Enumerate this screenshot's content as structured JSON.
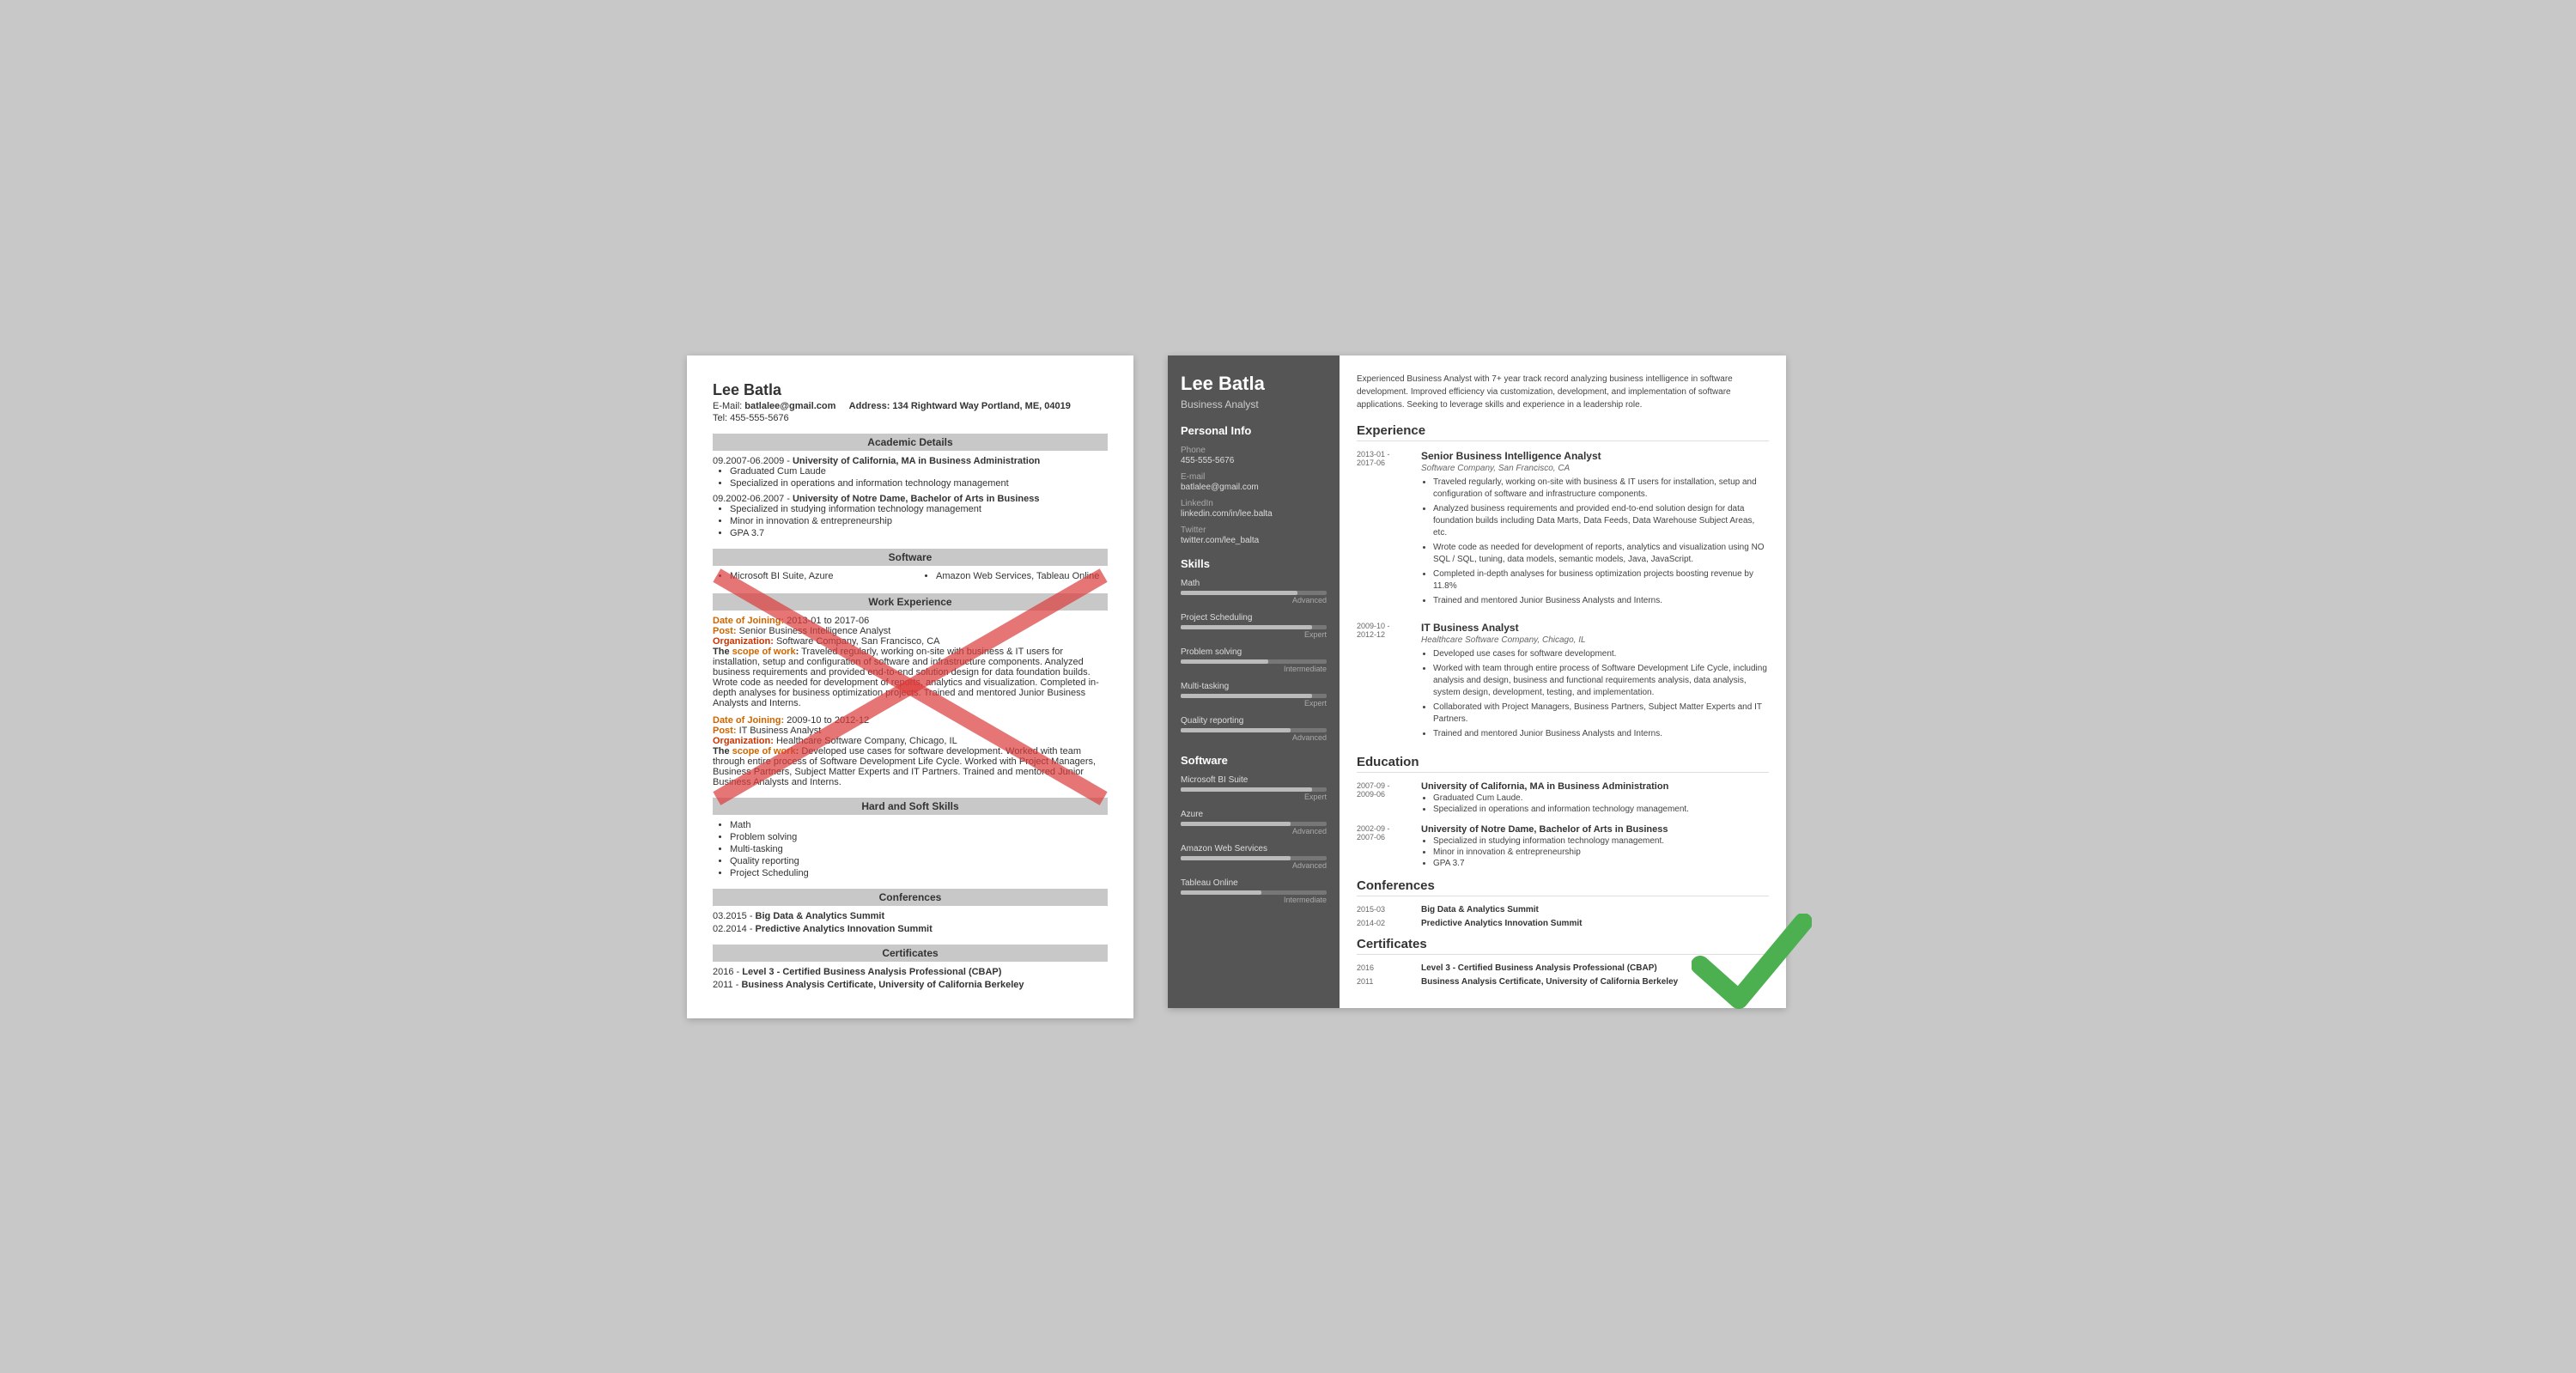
{
  "left_resume": {
    "name": "Lee Batla",
    "email": "batlalee@gmail.com",
    "address_label": "Address:",
    "address": "134 Rightward Way Portland, ME, 04019",
    "tel": "Tel: 455-555-5676",
    "sections": {
      "academic": "Academic Details",
      "software": "Software",
      "work": "Work Experience",
      "skills": "Hard and Soft Skills",
      "conferences": "Conferences",
      "certificates": "Certificates"
    },
    "education": [
      {
        "date": "09.2007-06.2009 -",
        "uni": "University of California, MA in Business Administration",
        "bullets": [
          "Graduated Cum Laude",
          "Specialized in operations and information technology management"
        ]
      },
      {
        "date": "09.2002-06.2007 -",
        "uni": "University of Notre Dame, Bachelor of Arts in Business",
        "bullets": [
          "Specialized in studying information technology management",
          "Minor in innovation & entrepreneurship",
          "GPA 3.7"
        ]
      }
    ],
    "software": [
      [
        "Microsoft BI Suite, Azure"
      ],
      [
        "Amazon Web Services, Tableau Online"
      ]
    ],
    "work": [
      {
        "date_label": "Date of Joining:",
        "date": "2013-01 to 2017-06",
        "post_label": "Post:",
        "post": "Senior Business Intelligence Analyst",
        "org_label": "Organization:",
        "org": "Software Company, San Francisco, CA",
        "scope_label": "The scope of work:",
        "scope": "Traveled regularly, working on-site with business & IT users for installation, setup and configuration of software and infrastructure components. Analyzed business requirements and provided end-to-end solution design for data foundation builds. Wrote code as needed for development of reports, analytics and visualization. Completed in-depth analyses for business optimization projects. Trained and mentored Junior Business Analysts and Interns."
      },
      {
        "date_label": "Date of Joining:",
        "date": "2009-10 to 2012-12",
        "post_label": "Post:",
        "post": "IT Business Analyst",
        "org_label": "Organization:",
        "org": "Healthcare Software Company, Chicago, IL",
        "scope_label": "The scope of work:",
        "scope": "Developed use cases for software development. Worked with team through entire process of Software Development Life Cycle. Worked with Project Managers, Business Partners, Subject Matter Experts and IT Partners. Trained and mentored Junior Business Analysts and Interns."
      }
    ],
    "skills": [
      "Math",
      "Problem solving",
      "Multi-tasking",
      "Quality reporting",
      "Project Scheduling"
    ],
    "conferences": [
      {
        "date": "03.2015 -",
        "name": "Big Data & Analytics Summit"
      },
      {
        "date": "02.2014 -",
        "name": "Predictive Analytics Innovation Summit"
      }
    ],
    "certificates": [
      {
        "date": "2016 -",
        "name": "Level 3 - Certified Business Analysis Professional (CBAP)"
      },
      {
        "date": "2011 -",
        "name": "Business Analysis Certificate, University of California Berkeley"
      }
    ]
  },
  "right_resume": {
    "name": "Lee Batla",
    "title": "Business Analyst",
    "summary": "Experienced Business Analyst with 7+ year track record analyzing business intelligence in software development. Improved efficiency via customization, development, and implementation of software applications. Seeking to leverage skills and experience in a leadership role.",
    "personal_info": {
      "section_title": "Personal Info",
      "phone_label": "Phone",
      "phone": "455-555-5676",
      "email_label": "E-mail",
      "email": "batlalee@gmail.com",
      "linkedin_label": "LinkedIn",
      "linkedin": "linkedin.com/in/lee.balta",
      "twitter_label": "Twitter",
      "twitter": "twitter.com/lee_balta"
    },
    "skills": {
      "section_title": "Skills",
      "items": [
        {
          "name": "Math",
          "pct": 80,
          "level": "Advanced"
        },
        {
          "name": "Project Scheduling",
          "pct": 90,
          "level": "Expert"
        },
        {
          "name": "Problem solving",
          "pct": 60,
          "level": "Intermediate"
        },
        {
          "name": "Multi-tasking",
          "pct": 90,
          "level": "Expert"
        },
        {
          "name": "Quality reporting",
          "pct": 75,
          "level": "Advanced"
        }
      ]
    },
    "software": {
      "section_title": "Software",
      "items": [
        {
          "name": "Microsoft BI Suite",
          "pct": 90,
          "level": "Expert"
        },
        {
          "name": "Azure",
          "pct": 75,
          "level": "Advanced"
        },
        {
          "name": "Amazon Web Services",
          "pct": 75,
          "level": "Advanced"
        },
        {
          "name": "Tableau Online",
          "pct": 55,
          "level": "Intermediate"
        }
      ]
    },
    "experience": {
      "section_title": "Experience",
      "items": [
        {
          "date": "2013-01 -\n2017-06",
          "title": "Senior Business Intelligence Analyst",
          "company": "Software Company, San Francisco, CA",
          "bullets": [
            "Traveled regularly, working on-site with business & IT users for installation, setup and configuration of software and infrastructure components.",
            "Analyzed business requirements and provided end-to-end solution design for data foundation builds including Data Marts, Data Feeds, Data Warehouse Subject Areas, etc.",
            "Wrote code as needed for development of reports, analytics and visualization using NO SQL / SQL, tuning, data models, semantic models, Java, JavaScript.",
            "Completed in-depth analyses for business optimization projects boosting revenue by 11.8%",
            "Trained and mentored Junior Business Analysts and Interns."
          ]
        },
        {
          "date": "2009-10 -\n2012-12",
          "title": "IT Business Analyst",
          "company": "Healthcare Software Company, Chicago, IL",
          "bullets": [
            "Developed use cases for software development.",
            "Worked with team through entire process of Software Development Life Cycle, including analysis and design, business and functional requirements analysis, data analysis, system design, development, testing, and implementation.",
            "Collaborated with Project Managers, Business Partners, Subject Matter Experts and IT Partners.",
            "Trained and mentored Junior Business Analysts and Interns."
          ]
        }
      ]
    },
    "education": {
      "section_title": "Education",
      "items": [
        {
          "date": "2007-09 -\n2009-06",
          "degree": "University of California, MA in Business Administration",
          "bullets": [
            "Graduated Cum Laude.",
            "Specialized in operations and information technology management."
          ]
        },
        {
          "date": "2002-09 -\n2007-06",
          "degree": "University of Notre Dame, Bachelor of Arts in Business",
          "bullets": [
            "Specialized in studying information technology management.",
            "Minor in innovation & entrepreneurship",
            "GPA 3.7"
          ]
        }
      ]
    },
    "conferences": {
      "section_title": "Conferences",
      "items": [
        {
          "date": "2015-03",
          "name": "Big Data & Analytics Summit"
        },
        {
          "date": "2014-02",
          "name": "Predictive Analytics Innovation Summit"
        }
      ]
    },
    "certificates": {
      "section_title": "Certificates",
      "items": [
        {
          "date": "2016",
          "name": "Level 3 - Certified Business Analysis Professional (CBAP)"
        },
        {
          "date": "2011",
          "name": "Business Analysis Certificate, University of California Berkeley"
        }
      ]
    }
  }
}
